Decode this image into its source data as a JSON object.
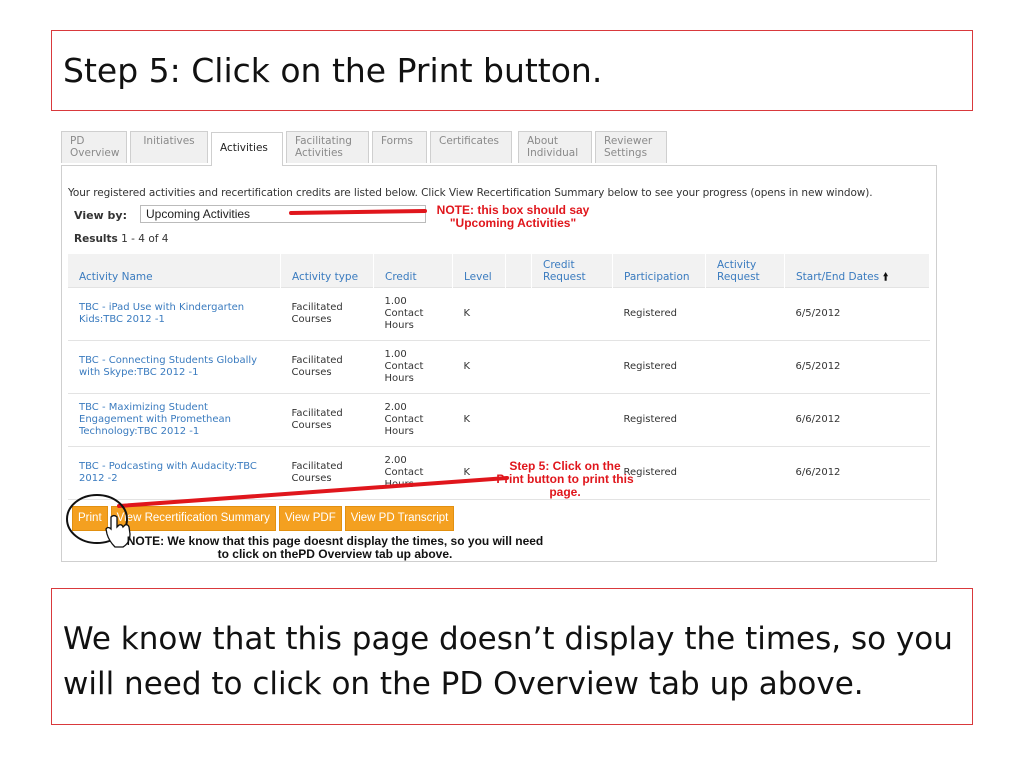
{
  "slide": {
    "title": "Step 5: Click on the Print button.",
    "note": "We know that this page doesn’t display the times, so you will need to click on the PD Overview tab up above."
  },
  "tabs": [
    {
      "label": "PD\nOverview",
      "active": false
    },
    {
      "label": "Initiatives",
      "active": false
    },
    {
      "label": "Activities",
      "active": true
    },
    {
      "label": "Facilitating\nActivities",
      "active": false
    },
    {
      "label": "Forms",
      "active": false
    },
    {
      "label": "Certificates",
      "active": false
    },
    {
      "label": "About\nIndividual",
      "active": false
    },
    {
      "label": "Reviewer\nSettings",
      "active": false
    }
  ],
  "intro": "Your registered activities and recertification credits are listed below. Click View Recertification Summary below to see your progress (opens in new window).",
  "view_by": {
    "label": "View by:",
    "value": "Upcoming Activities"
  },
  "results": {
    "label": "Results",
    "range": "1 - 4 of 4"
  },
  "columns": [
    "Activity Name",
    "Activity type",
    "Credit",
    "Level",
    "",
    "Credit Request",
    "Participation",
    "Activity Request",
    "Start/End Dates"
  ],
  "rows": [
    {
      "name": "TBC - iPad Use with Kindergarten Kids:TBC 2012 -1",
      "type": "Facilitated Courses",
      "credit": "1.00 Contact Hours",
      "level": "K",
      "participation": "Registered",
      "dates": "6/5/2012"
    },
    {
      "name": "TBC - Connecting Students Globally with Skype:TBC 2012 -1",
      "type": "Facilitated Courses",
      "credit": "1.00 Contact Hours",
      "level": "K",
      "participation": "Registered",
      "dates": "6/5/2012"
    },
    {
      "name": "TBC - Maximizing Student Engagement with Promethean Technology:TBC 2012 -1",
      "type": "Facilitated Courses",
      "credit": "2.00 Contact Hours",
      "level": "K",
      "participation": "Registered",
      "dates": "6/6/2012"
    },
    {
      "name": "TBC - Podcasting with Audacity:TBC 2012 -2",
      "type": "Facilitated Courses",
      "credit": "2.00 Contact Hours",
      "level": "K",
      "participation": "Registered",
      "dates": "6/6/2012"
    }
  ],
  "buttons": {
    "print": "Print",
    "recert_summary": "View Recertification Summary",
    "pdf": "View PDF",
    "transcript": "View PD Transcript"
  },
  "annotations": {
    "viewby_note": "NOTE: this box should say \"Upcoming Activities\"",
    "print_note": "Step 5: Click on the Print button to print this page.",
    "times_note": "NOTE:  We know that this page doesnt display the times, so you will need to click on thePD Overview tab up above."
  },
  "colors": {
    "frame_red": "#d9393c",
    "link_blue": "#3a7bbf",
    "button_orange": "#f4a020",
    "annotation_red": "#e0161c"
  }
}
